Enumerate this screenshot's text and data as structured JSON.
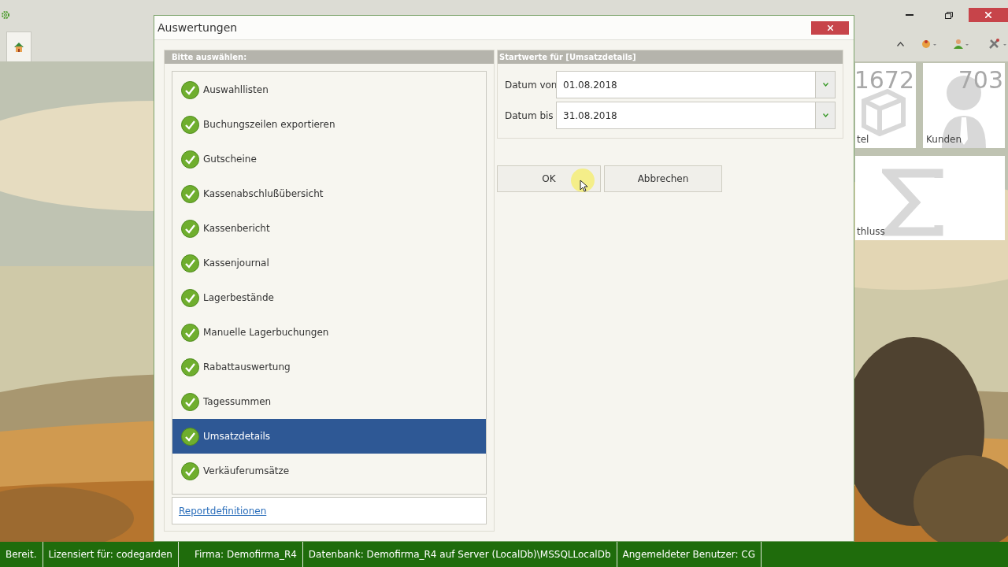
{
  "app": {
    "tiles": [
      {
        "number": "1672",
        "label": "tel",
        "kind": "box"
      },
      {
        "number": "703",
        "label": "Kunden",
        "kind": "person"
      },
      {
        "label": "thluss",
        "kind": "sigma"
      }
    ]
  },
  "dialog": {
    "title": "Auswertungen",
    "list_header": "Bitte auswählen:",
    "reports": [
      {
        "label": "Auswahllisten",
        "selected": false
      },
      {
        "label": "Buchungszeilen exportieren",
        "selected": false
      },
      {
        "label": "Gutscheine",
        "selected": false
      },
      {
        "label": "Kassenabschlußübersicht",
        "selected": false
      },
      {
        "label": "Kassenbericht",
        "selected": false
      },
      {
        "label": "Kassenjournal",
        "selected": false
      },
      {
        "label": "Lagerbestände",
        "selected": false
      },
      {
        "label": "Manuelle Lagerbuchungen",
        "selected": false
      },
      {
        "label": "Rabattauswertung",
        "selected": false
      },
      {
        "label": "Tagessummen",
        "selected": false
      },
      {
        "label": "Umsatzdetails",
        "selected": true
      },
      {
        "label": "Verkäuferumsätze",
        "selected": false
      }
    ],
    "link": "Reportdefinitionen",
    "params_header": "Startwerte für [Umsatzdetails]",
    "fields": [
      {
        "label": "Datum von",
        "value": "01.08.2018"
      },
      {
        "label": "Datum bis",
        "value": "31.08.2018"
      }
    ],
    "buttons": [
      "OK",
      "Abbrechen"
    ]
  },
  "status_bar": [
    "Bereit.",
    "Lizensiert für: codegarden",
    "Firma: Demofirma_R4",
    "Datenbank: Demofirma_R4 auf Server (LocalDb)\\MSSQLLocalDb",
    "Angemeldeter Benutzer: CG"
  ]
}
